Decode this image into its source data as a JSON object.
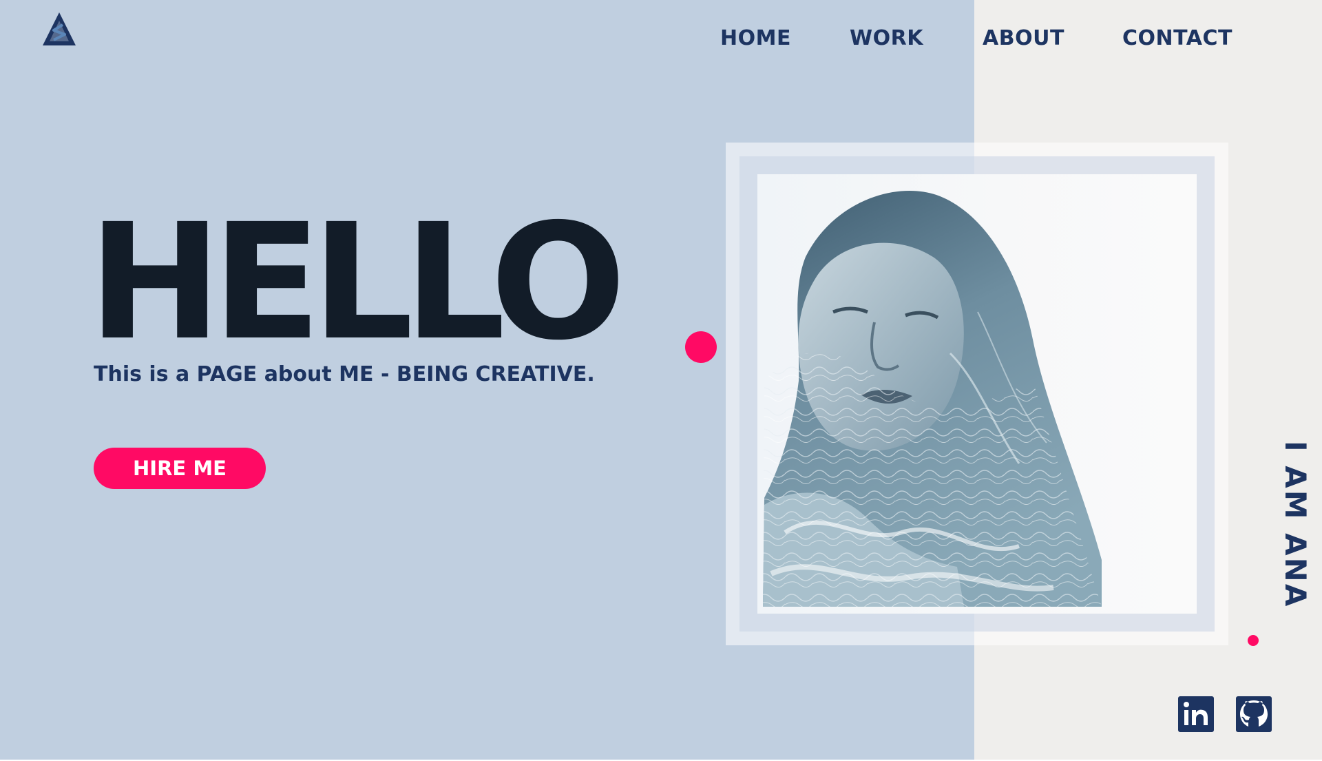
{
  "nav": {
    "items": [
      {
        "label": "HOME"
      },
      {
        "label": "WORK"
      },
      {
        "label": "ABOUT"
      },
      {
        "label": "CONTACT"
      }
    ]
  },
  "hero": {
    "title": "HELLO",
    "subtitle": "This is a PAGE about ME - BEING CREATIVE.",
    "cta_label": "HIRE ME"
  },
  "side": {
    "vertical_text": "I AM ANA"
  },
  "social": {
    "icons": [
      "linkedin-icon",
      "github-icon"
    ]
  },
  "colors": {
    "background_left": "#c0cfe0",
    "background_right": "#efeeec",
    "accent": "#ff0a64",
    "navy": "#1d3461",
    "title": "#121c28"
  }
}
